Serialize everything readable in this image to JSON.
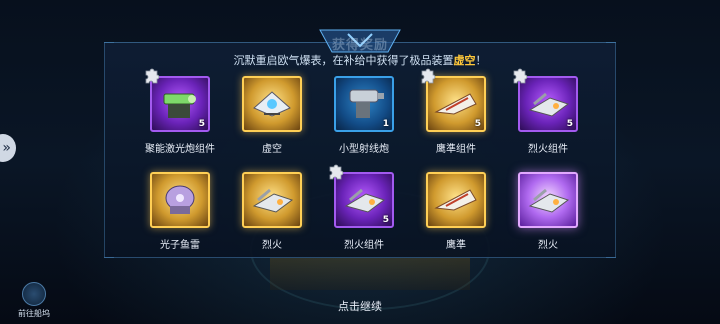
{
  "header": {
    "title": "获得奖励",
    "subtitle_prefix": "沉默重启欧气爆表，在补给中获得了极品装置",
    "subtitle_highlight": "虚空",
    "subtitle_suffix": "！"
  },
  "items": [
    {
      "name": "聚能激光炮组件",
      "count": "5",
      "rarity": "purple",
      "fragment": true,
      "icon": "laser-cannon-icon"
    },
    {
      "name": "虚空",
      "count": "",
      "rarity": "gold",
      "fragment": false,
      "icon": "void-ship-icon"
    },
    {
      "name": "小型射线炮",
      "count": "1",
      "rarity": "blue",
      "fragment": false,
      "icon": "ray-cannon-icon"
    },
    {
      "name": "鹰準组件",
      "count": "5",
      "rarity": "gold",
      "fragment": true,
      "icon": "eagle-ship-icon"
    },
    {
      "name": "烈火组件",
      "count": "5",
      "rarity": "purple",
      "fragment": true,
      "icon": "blaze-ship-icon"
    },
    {
      "name": "光子鱼雷",
      "count": "",
      "rarity": "gold",
      "fragment": false,
      "icon": "photon-torpedo-icon"
    },
    {
      "name": "烈火",
      "count": "",
      "rarity": "gold",
      "fragment": false,
      "icon": "blaze-ship-icon"
    },
    {
      "name": "烈火组件",
      "count": "5",
      "rarity": "purple",
      "fragment": true,
      "icon": "blaze-ship-icon"
    },
    {
      "name": "鹰準",
      "count": "",
      "rarity": "gold",
      "fragment": false,
      "icon": "eagle-ship-icon"
    },
    {
      "name": "烈火",
      "count": "",
      "rarity": "bright",
      "fragment": false,
      "icon": "blaze-ship-icon"
    }
  ],
  "footer": {
    "continue_label": "点击继续",
    "dock_label": "前往船坞"
  },
  "colors": {
    "highlight": "#ffc83a",
    "gold": "#ffcf55",
    "purple": "#a35af0",
    "blue": "#3aa0e8"
  }
}
